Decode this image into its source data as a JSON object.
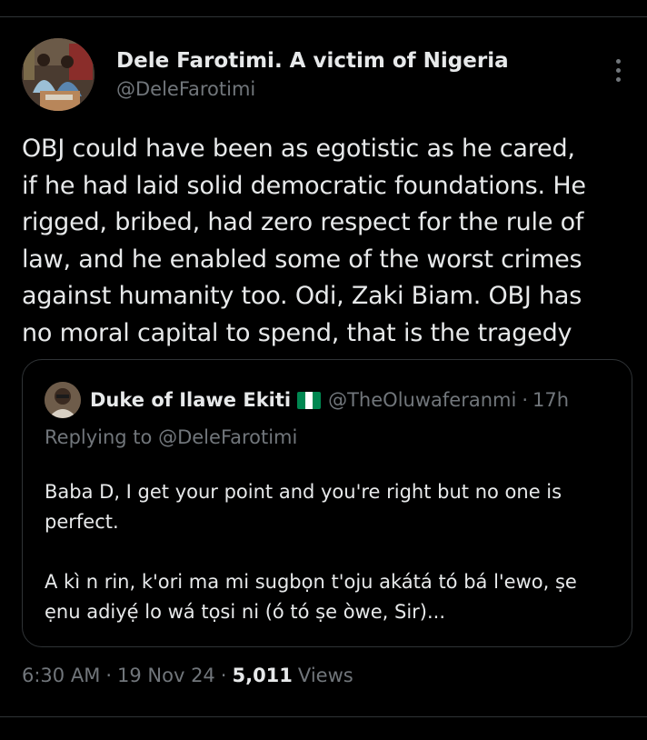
{
  "author": {
    "name": "Dele Farotimi. A victim of Nigeria",
    "handle": "@DeleFarotimi",
    "avatar": "avatar-photo"
  },
  "more_icon": "more-vertical-icon",
  "tweet": {
    "lines": [
      "OBJ could have been as egotistic as he cared,",
      "if he had laid solid democratic foundations. He",
      "rigged, bribed, had zero respect for the rule of",
      "law, and he enabled some of the worst crimes",
      "against humanity too. Odi, Zaki Biam. OBJ has",
      "no moral capital to spend, that is the tragedy"
    ]
  },
  "quote": {
    "name": "Duke of Ilawe Ekiti",
    "flag": "nigeria-flag-icon",
    "flag_colors": [
      "#008751",
      "#ffffff",
      "#008751"
    ],
    "handle": "@TheOluwaferanmi",
    "dot": "·",
    "time": "17h",
    "replying_prefix": "Replying to",
    "replying_to": "@DeleFarotimi",
    "paragraphs": [
      "Baba D, I get your point and you're right but no one is perfect.",
      "A kì n rin, k'ori ma mi sugbọn t'oju akátá tó bá l'ewo, ṣe ẹnu adiyẹ́ lo wá tọsi ni (ó tó ṣe òwe, Sir)..."
    ]
  },
  "meta": {
    "time": "6:30 AM",
    "sep1": "·",
    "date": "19 Nov 24",
    "sep2": "·",
    "views_count": "5,011",
    "views_label": "Views"
  },
  "colors": {
    "background": "#000000",
    "text": "#e7e9ea",
    "secondary": "#71767b",
    "border": "#2f3336"
  }
}
